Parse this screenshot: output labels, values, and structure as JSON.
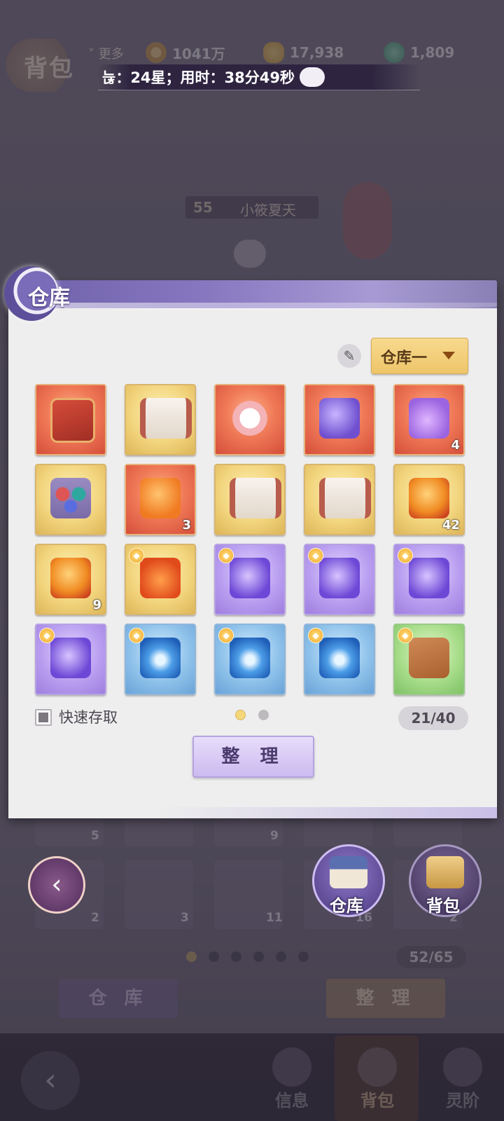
{
  "top_bar": {
    "screen_title": "背包",
    "more_label": "更多",
    "currencies": [
      {
        "icon": "coin-icon",
        "value": "1041万"
      },
      {
        "icon": "gold-ingot-icon",
        "value": "17,938"
      },
      {
        "icon": "jade-icon",
        "value": "1,809"
      }
    ]
  },
  "marquee": {
    "text": "늖：24星；用时：38分49秒"
  },
  "player": {
    "level": "55",
    "name": "小筱夏天"
  },
  "dialog": {
    "title": "仓库",
    "warehouse_selector": "仓库一",
    "items": [
      {
        "frame": "red",
        "art": "chest",
        "qty": "",
        "badge": false
      },
      {
        "frame": "gold",
        "art": "scroll",
        "qty": "",
        "badge": false
      },
      {
        "frame": "red",
        "art": "bow",
        "qty": "",
        "badge": false
      },
      {
        "frame": "red",
        "art": "orb-purple",
        "qty": "",
        "badge": false
      },
      {
        "frame": "red",
        "art": "bag",
        "qty": "4",
        "badge": false
      },
      {
        "frame": "gold",
        "art": "tri-orb",
        "qty": "",
        "badge": false
      },
      {
        "frame": "red",
        "art": "fox-orb",
        "qty": "3",
        "badge": false
      },
      {
        "frame": "gold",
        "art": "scroll",
        "qty": "",
        "badge": false
      },
      {
        "frame": "gold",
        "art": "scroll",
        "qty": "",
        "badge": false
      },
      {
        "frame": "gold",
        "art": "fire-orb",
        "qty": "42",
        "badge": false
      },
      {
        "frame": "gold",
        "art": "fire-orb",
        "qty": "9",
        "badge": false
      },
      {
        "frame": "gold",
        "art": "pouch",
        "qty": "",
        "badge": true
      },
      {
        "frame": "purple",
        "art": "pendant-purple",
        "qty": "",
        "badge": true
      },
      {
        "frame": "purple",
        "art": "pendant-purple",
        "qty": "",
        "badge": true
      },
      {
        "frame": "purple",
        "art": "pendant-purple",
        "qty": "",
        "badge": true
      },
      {
        "frame": "purple",
        "art": "pendant-purple",
        "qty": "",
        "badge": true
      },
      {
        "frame": "blue",
        "art": "pendant-blue",
        "qty": "",
        "badge": true
      },
      {
        "frame": "blue",
        "art": "pendant-blue",
        "qty": "",
        "badge": true
      },
      {
        "frame": "blue",
        "art": "pendant-blue",
        "qty": "",
        "badge": true
      },
      {
        "frame": "green",
        "art": "wood",
        "qty": "",
        "badge": true
      }
    ],
    "quick_access_label": "快速存取",
    "capacity": "21/40",
    "sort_label": "整 理"
  },
  "toggles": {
    "warehouse_label": "仓库",
    "bag_label": "背包"
  },
  "background_bag": {
    "item_counts": [
      "5",
      "9",
      "2",
      "3",
      "11",
      "16",
      "2"
    ],
    "capacity": "52/65",
    "warehouse_button": "仓 库",
    "sort_button": "整 理"
  },
  "bottom_nav": {
    "items": [
      "信息",
      "背包",
      "灵阶"
    ]
  }
}
